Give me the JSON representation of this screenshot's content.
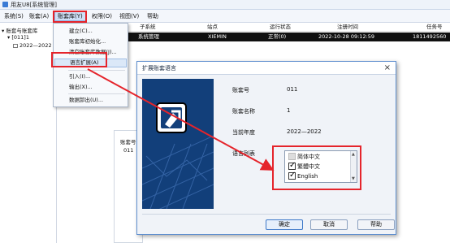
{
  "window": {
    "title": "用友U8[系统管理]"
  },
  "menubar": {
    "items": [
      {
        "label": "系统(S)"
      },
      {
        "label": "账套(A)"
      },
      {
        "label": "账套库(Y)"
      },
      {
        "label": "权限(O)"
      },
      {
        "label": "视图(V)"
      },
      {
        "label": "帮助"
      }
    ]
  },
  "tree": {
    "root": "账套与账套库",
    "child": "[011]1",
    "leaf": "2022—2022"
  },
  "grid": {
    "headers": [
      "子系统",
      "站点",
      "运行状态",
      "注册时间",
      "任务号"
    ],
    "row": [
      "系统管理",
      "XIEMIN",
      "正常(0)",
      "2022-10-28 09:12:59",
      "1811492560"
    ]
  },
  "dropdown": {
    "items": [
      {
        "label": "建立(C)..."
      },
      {
        "label": "账套库初始化..."
      },
      {
        "label": "清空账套库数据(J)..."
      },
      {
        "label": "语言扩展(A)"
      },
      {
        "label": "引入(I)..."
      },
      {
        "label": "输出(X)..."
      },
      {
        "label": "数据卸出(U)..."
      }
    ]
  },
  "bottom_pane": {
    "header": "账套号",
    "value": "011"
  },
  "dialog": {
    "title": "扩展账套语言",
    "close_glyph": "×",
    "fields": [
      {
        "label": "账套号",
        "value": "011"
      },
      {
        "label": "账套名称",
        "value": "1"
      },
      {
        "label": "当前年度",
        "value": "2022—2022"
      }
    ],
    "lang_list_label": "语言列表",
    "languages": [
      {
        "label": "简体中文",
        "checked": false
      },
      {
        "label": "繁體中文",
        "checked": true
      },
      {
        "label": "English",
        "checked": true
      }
    ],
    "buttons": {
      "ok": "确定",
      "cancel": "取消",
      "help": "帮助"
    }
  },
  "colors": {
    "highlight": "#e5242b",
    "dialog_border": "#5f8fcf",
    "picture_bg": "#123f7a",
    "grid_row_bg": "#101010"
  }
}
